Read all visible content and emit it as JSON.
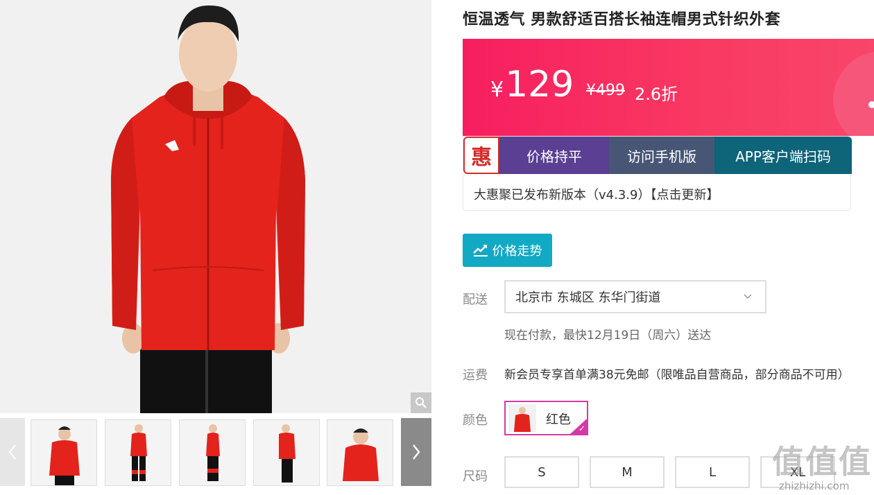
{
  "product": {
    "title": "恒温透气 男款舒适百搭长袖连帽男式针织外套"
  },
  "price": {
    "currency": "¥",
    "current": "129",
    "original": "¥499",
    "discount": "2.6折",
    "banner_color": "#f71e5f"
  },
  "promo": {
    "logo_char": "惠",
    "buttons": [
      "价格持平",
      "访问手机版",
      "APP客户端扫码"
    ],
    "update_text": "大惠聚已发布新版本（v4.3.9）【点击更新】"
  },
  "trend": {
    "label": "价格走势",
    "color": "#12a9c4"
  },
  "delivery": {
    "label": "配送",
    "address": "北京市 东城区 东华门街道",
    "note": "现在付款，最快12月19日（周六）送达"
  },
  "shipping": {
    "label": "运费",
    "text": "新会员专享首单满38元免邮（限唯品自营商品，部分商品不可用）"
  },
  "color": {
    "label": "颜色",
    "selected": "红色",
    "accent": "#d43aa6"
  },
  "size": {
    "label": "尺码",
    "options": [
      "S",
      "M",
      "L",
      "XL"
    ]
  },
  "gallery": {
    "icons": [
      "zoom-icon",
      "chevron-left-icon",
      "chevron-right-icon"
    ]
  },
  "watermark": {
    "main": "值值值",
    "site": "zhizhizhi.com"
  }
}
